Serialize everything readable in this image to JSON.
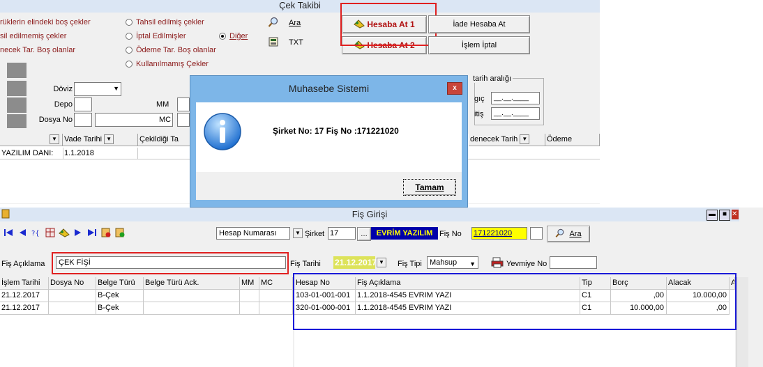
{
  "top_window": {
    "title": "Çek Takibi",
    "left_options": [
      "rüklerin elindeki boş çekler",
      "sil edilmemiş çekler",
      "necek Tar. Boş olanlar"
    ],
    "mid_options": [
      "Tahsil edilmiş çekler",
      "İptal Edilmişler",
      "Ödeme Tar. Boş olanlar",
      "Kullanılmamış Çekler"
    ],
    "diger_label": "Diğer",
    "buttons": {
      "ara": "Ara",
      "txt": "TXT",
      "hesaba_at_1": "Hesaba At 1",
      "hesaba_at_2": "Hesaba At 2",
      "iade_hesaba_at": "İade Hesaba At",
      "islem_iptal": "İşlem İptal"
    },
    "fields": {
      "doviz": "Döviz",
      "depo": "Depo",
      "dosya_no": "Dosya No",
      "mm": "MM",
      "mc": "MC"
    },
    "date_range": {
      "legend": "tarih aralığı",
      "start": "gıç",
      "end": "itiş",
      "placeholder": "__.__.____"
    },
    "columns": [
      "Vade Tarihi",
      "Çekildiği Ta",
      "denecek Tarih",
      "Ödeme"
    ],
    "row": {
      "name": "YAZILIM DANI:",
      "vade": "1.1.2018"
    }
  },
  "dialog": {
    "title": "Muhasebe Sistemi",
    "message": "Şirket No: 17 Fiş No :171221020",
    "ok_button": "Tamam",
    "close": "x"
  },
  "bottom_window": {
    "title": "Fiş Girişi",
    "toolbar": {
      "account_select": "Hesap Numarası",
      "sirket_label": "Şirket",
      "sirket_value": "17",
      "company_name": "EVRİM YAZILIM",
      "fis_no_label": "Fiş No",
      "fis_no_value": "171221020",
      "ara": "Ara"
    },
    "form": {
      "fis_aciklama_label": "Fiş Açıklama",
      "fis_aciklama_value": "ÇEK FİŞİ",
      "tarih_label": "Fiş Tarihi",
      "tarih_value": "21.12.2017",
      "fis_tipi_label": "Fiş Tipi",
      "fis_tipi_value": "Mahsup",
      "yevmiye_label": "Yevmiye No"
    },
    "left_columns": [
      "İşlem Tarihi",
      "Dosya No",
      "Belge Türü",
      "Belge Türü Ack.",
      "MM",
      "MC"
    ],
    "left_rows": [
      [
        "21.12.2017",
        "",
        "B-Çek",
        "",
        "",
        ""
      ],
      [
        "21.12.2017",
        "",
        "B-Çek",
        "",
        "",
        ""
      ]
    ],
    "right_columns": [
      "Hesap No",
      "Fiş Açıklama",
      "Tip",
      "Borç",
      "Alacak",
      "A"
    ],
    "right_rows": [
      [
        "103-01-001-001",
        "1.1.2018-4545 EVRIM YAZI",
        "C1",
        ",00",
        "10.000,00"
      ],
      [
        "320-01-000-001",
        "1.1.2018-4545 EVRIM YAZI",
        "C1",
        "10.000,00",
        ",00"
      ]
    ]
  },
  "colors": {
    "highlight_red": "#e02020",
    "highlight_blue": "#1a1ad8",
    "company_bg": "#0000aa",
    "company_fg": "#ffff00",
    "field_yellow": "#ffff00"
  }
}
